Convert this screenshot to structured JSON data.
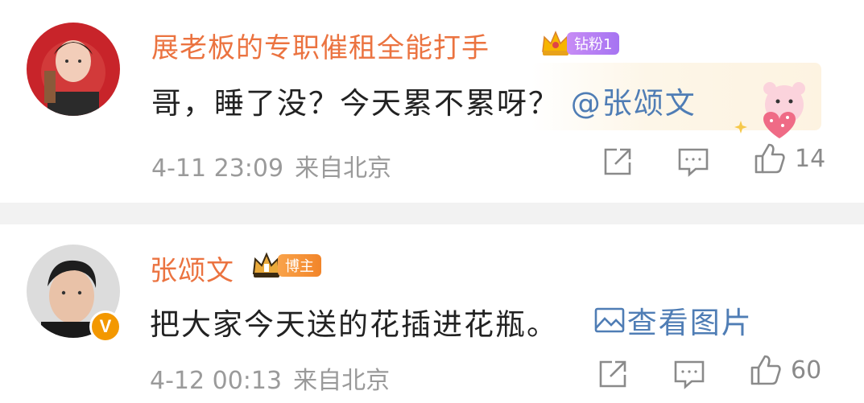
{
  "comments": [
    {
      "username": "展老板的专职催租全能打手",
      "badge_label": "钻粉1",
      "text": "哥，睡了没？今天累不累呀？",
      "mention": "@张颂文",
      "date": "4-11 23:09",
      "source": "来自北京",
      "likes": "14"
    },
    {
      "username": "张颂文",
      "badge_label": "博主",
      "verified_mark": "V",
      "text": "把大家今天送的花插进花瓶。",
      "view_pic_label": "查看图片",
      "date": "4-12 00:13",
      "source": "来自北京",
      "likes": "60"
    }
  ],
  "colors": {
    "username": "#eb7340",
    "link": "#4f7db5",
    "meta": "#9a9a9a",
    "divider": "#f2f2f2"
  },
  "icons": [
    "share-icon",
    "reply-icon",
    "like-icon",
    "crown-icon",
    "image-icon",
    "bear-sticker-icon"
  ]
}
